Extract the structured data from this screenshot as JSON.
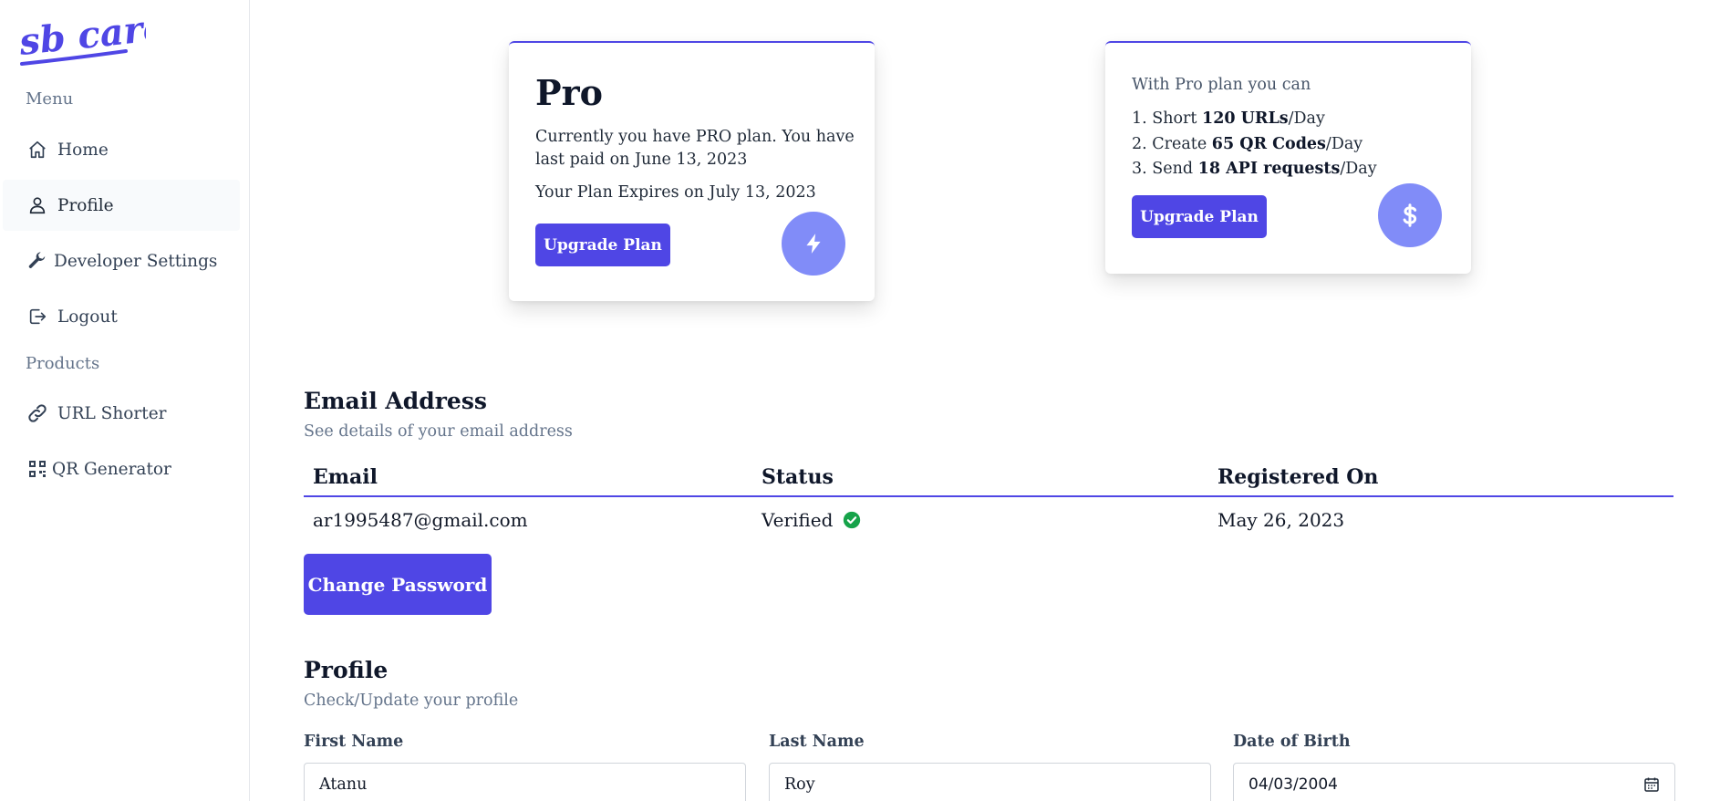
{
  "brand": {
    "logo_text": "sb care",
    "accent_color": "#4f46e5",
    "icon_circle_color": "#818cf8"
  },
  "sidebar": {
    "menu_label": "Menu",
    "items": [
      {
        "label": "Home",
        "icon": "home-icon"
      },
      {
        "label": "Profile",
        "icon": "user-icon",
        "active": true
      },
      {
        "label": "Developer Settings",
        "icon": "wrench-icon"
      },
      {
        "label": "Logout",
        "icon": "logout-icon"
      }
    ],
    "products_label": "Products",
    "products": [
      {
        "label": "URL Shorter",
        "icon": "link-icon"
      },
      {
        "label": "QR Generator",
        "icon": "qr-code-icon"
      }
    ]
  },
  "plan_card": {
    "title": "Pro",
    "description": "Currently you have PRO plan. You have last paid on June 13, 2023",
    "expiry": "Your Plan Expires on July 13, 2023",
    "button_label": "Upgrade Plan",
    "icon": "lightning-icon"
  },
  "features_card": {
    "intro": "With Pro plan you can",
    "features": [
      {
        "prefix": "1. Short ",
        "bold": "120 URLs",
        "suffix": "/Day"
      },
      {
        "prefix": "2. Create ",
        "bold": "65 QR Codes",
        "suffix": "/Day"
      },
      {
        "prefix": "3. Send ",
        "bold": "18 API requests",
        "suffix": "/Day"
      }
    ],
    "button_label": "Upgrade Plan",
    "icon": "dollar-icon"
  },
  "email_section": {
    "title": "Email Address",
    "subtitle": "See details of your email address",
    "columns": [
      "Email",
      "Status",
      "Registered On"
    ],
    "row": {
      "email": "ar1995487@gmail.com",
      "status": "Verified",
      "registered_on": "May 26, 2023"
    },
    "status_color": "#16a34a",
    "change_password_label": "Change Password"
  },
  "profile_section": {
    "title": "Profile",
    "subtitle": "Check/Update your profile",
    "first_name_label": "First Name",
    "first_name_value": "Atanu",
    "last_name_label": "Last Name",
    "last_name_value": "Roy",
    "dob_label": "Date of Birth",
    "dob_value": "04/03/2004"
  }
}
